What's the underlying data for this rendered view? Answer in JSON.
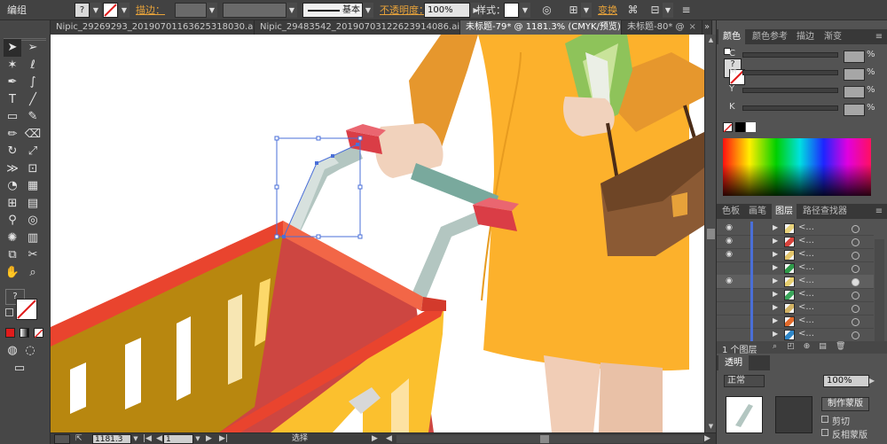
{
  "control_bar": {
    "mode_label": "编组",
    "stroke_label": "描边：",
    "stroke_style": "基本",
    "opacity_label": "不透明度：",
    "opacity_value": "100%",
    "style_label": "样式：",
    "transform_label": "变换"
  },
  "tabs": [
    {
      "label": "Nipic_29269293_20190701163625318030.ai*",
      "close": "×",
      "active": false
    },
    {
      "label": "Nipic_29483542_20190703122623914086.ai*",
      "close": "×",
      "active": false
    },
    {
      "label": "未标题-79* @ 1181.3% (CMYK/预览)",
      "close": "×",
      "active": true
    },
    {
      "label": "未标题-80* @",
      "close": "×",
      "active": false
    }
  ],
  "tools": {
    "icons": [
      "selection-tool-icon",
      "direct-selection-tool-icon",
      "magic-wand-tool-icon",
      "lasso-tool-icon",
      "pen-tool-icon",
      "curvature-tool-icon",
      "type-tool-icon",
      "line-tool-icon",
      "rectangle-tool-icon",
      "paintbrush-tool-icon",
      "pencil-tool-icon",
      "eraser-tool-icon",
      "rotate-tool-icon",
      "scale-tool-icon",
      "width-tool-icon",
      "free-transform-tool-icon",
      "shape-builder-tool-icon",
      "perspective-grid-tool-icon",
      "mesh-tool-icon",
      "gradient-tool-icon",
      "eyedropper-tool-icon",
      "blend-tool-icon",
      "symbol-sprayer-tool-icon",
      "column-graph-tool-icon",
      "artboard-tool-icon",
      "slice-tool-icon",
      "hand-tool-icon",
      "zoom-tool-icon"
    ],
    "help_glyph": "?"
  },
  "status_bar": {
    "zoom_value": "1181.3",
    "page_value": "1",
    "tool_name": "选择"
  },
  "color_panel": {
    "tabs": [
      "颜色",
      "颜色参考",
      "描边",
      "渐变"
    ],
    "sliders": [
      {
        "label": "C",
        "unit": "%"
      },
      {
        "label": "M",
        "unit": "%"
      },
      {
        "label": "Y",
        "unit": "%"
      },
      {
        "label": "K",
        "unit": "%"
      }
    ],
    "help_glyph": "?"
  },
  "layers_panel": {
    "tabs": [
      "色板",
      "画笔",
      "图层",
      "路径查找器"
    ],
    "rows": [
      {
        "name": "<...",
        "visible": true,
        "selected": false,
        "thumb_color": "#e8d27a"
      },
      {
        "name": "<...",
        "visible": true,
        "selected": false,
        "thumb_color": "#d8433c"
      },
      {
        "name": "<...",
        "visible": true,
        "selected": false,
        "thumb_color": "#e3c56a"
      },
      {
        "name": "<...",
        "visible": false,
        "selected": false,
        "thumb_color": "#2f9b4a"
      },
      {
        "name": "<...",
        "visible": true,
        "selected": true,
        "thumb_color": "#e7cf6f"
      },
      {
        "name": "<...",
        "visible": false,
        "selected": false,
        "thumb_color": "#3aa65a"
      },
      {
        "name": "<...",
        "visible": false,
        "selected": false,
        "thumb_color": "#d2b263"
      },
      {
        "name": "<...",
        "visible": false,
        "selected": false,
        "thumb_color": "#e36a2a"
      },
      {
        "name": "<...",
        "visible": false,
        "selected": false,
        "thumb_color": "#2f87c9"
      }
    ],
    "count_label": "1 个图层"
  },
  "transparency_panel": {
    "title": "透明",
    "blend_mode": "正常",
    "opacity_value": "100%",
    "make_mask_button": "制作蒙版",
    "clip_label": "剪切",
    "invert_label": "反相蒙版"
  },
  "colors": {
    "accent_orange": "#e8a33a",
    "dress": "#fcb12c",
    "arm": "#e6972d",
    "cart_red": "#e9442e",
    "cart_inner": "#cd4641",
    "cart_yellow": "#fbc02e",
    "cart_gold": "#b8870f",
    "handle_teal": "#79a99d",
    "handle_red": "#da3d46",
    "bag_brown": "#8b5a34",
    "skin": "#f1d2bc"
  }
}
